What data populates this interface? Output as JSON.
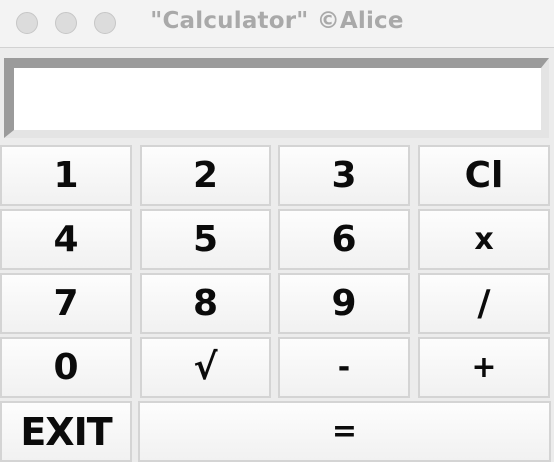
{
  "window": {
    "title": "\"Calculator\" ©Alice"
  },
  "display": {
    "value": ""
  },
  "keys": {
    "k1": "1",
    "k2": "2",
    "k3": "3",
    "clear": "Cl",
    "k4": "4",
    "k5": "5",
    "k6": "6",
    "multiply": "x",
    "k7": "7",
    "k8": "8",
    "k9": "9",
    "divide": "/",
    "k0": "0",
    "sqrt": "√",
    "minus": "-",
    "plus": "+",
    "exit": "EXIT",
    "equals": "="
  }
}
